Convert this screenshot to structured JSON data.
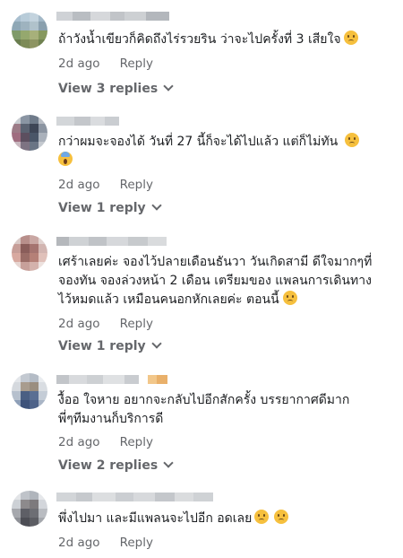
{
  "comments": [
    {
      "text": "ถ้าวังน้ำเขียวก็คิดถึงไร่รวยริน ว่าจะไปครั้งที่ 3 เสียใจ",
      "emojis": [
        "sad-face-emoji"
      ],
      "time": "2d ago",
      "reply_label": "Reply",
      "replies_label": "View 3 replies"
    },
    {
      "text": "กว่าผมจะจองได้ วันที่ 27 นี้ก็จะได้ไปแล้ว แต่ก็ไม่ทัน",
      "emojis": [
        "sad-face-emoji",
        "screaming-face-emoji"
      ],
      "time": "2d ago",
      "reply_label": "Reply",
      "replies_label": "View 1 reply"
    },
    {
      "text": "เศร้าเลยค่ะ จองไว้ปลายเดือนธันวา วันเกิดสามี ดีใจมากๆที่\nจองทัน จองล่วงหน้า 2 เดือน เตรียมของ แพลนการเดินทาง\nไว้หมดแล้ว เหมือนคนอกหักเลยค่ะ ตอนนี้",
      "emojis": [
        "sad-face-emoji"
      ],
      "time": "2d ago",
      "reply_label": "Reply",
      "replies_label": "View 1 reply"
    },
    {
      "text": "งื้ออ ใจหาย อยากจะกลับไปอีกสักครั้ง บรรยากาศดีมาก\nพี่ๆทีมงานก็บริการดี",
      "emojis": [],
      "time": "2d ago",
      "reply_label": "Reply",
      "replies_label": "View 2 replies"
    },
    {
      "text": "พึ่งไปมา และมีแพลนจะไปอีก อดเลย",
      "emojis": [
        "sad-face-emoji",
        "sad-face-emoji"
      ],
      "time": "2d ago",
      "reply_label": "Reply",
      "replies_label": ""
    }
  ],
  "colors": {
    "text": "#1c1e21",
    "meta": "#65676b",
    "emoji": "#f6c03e"
  }
}
